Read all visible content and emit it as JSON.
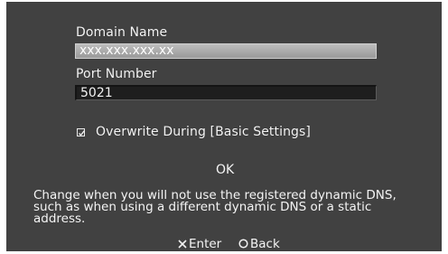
{
  "domain_name": {
    "label": "Domain Name",
    "value": "xxx.xxx.xxx.xx"
  },
  "port_number": {
    "label": "Port Number",
    "value": "5021"
  },
  "overwrite": {
    "label": "Overwrite During [Basic Settings]",
    "checked": true
  },
  "ok_label": "OK",
  "description": {
    "line1": "Change when you will not use the registered dynamic DNS,",
    "line2": "such as when using a different dynamic DNS or a static",
    "line3": "address."
  },
  "controls": {
    "enter_icon": "cross-icon",
    "enter_label": "Enter",
    "back_icon": "circle-icon",
    "back_label": "Back"
  }
}
